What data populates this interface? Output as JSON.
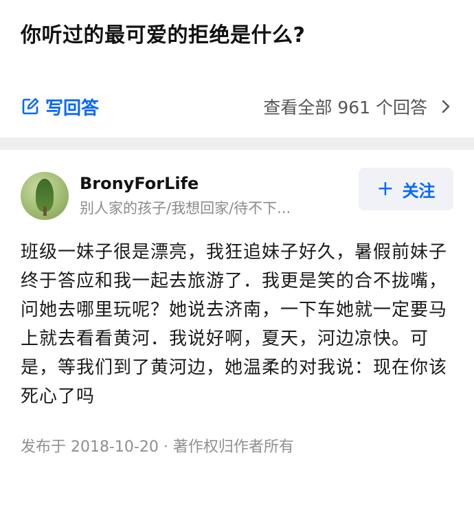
{
  "question": {
    "title": "你听过的最可爱的拒绝是什么?"
  },
  "actions": {
    "write_answer_label": "写回答",
    "view_all_label": "查看全部 961 个回答"
  },
  "answer": {
    "author_name": "BronyForLife",
    "author_bio": "别人家的孩子/我想回家/待不下...",
    "follow_label": "关注",
    "body": "班级一妹子很是漂亮，我狂追妹子好久，暑假前妹子终于答应和我一起去旅游了．我更是笑的合不拢嘴，问她去哪里玩呢？她说去济南，一下车她就一定要马上就去看看黄河．我说好啊，夏天，河边凉快。可是，等我们到了黄河边，她温柔的对我说：现在你该死心了吗",
    "meta": "发布于 2018-10-20 · 著作权归作者所有"
  },
  "colors": {
    "accent": "#0066ff",
    "divider": "#eeeeee",
    "muted": "#8f8f8f",
    "follow_bg": "#f0f2f7"
  },
  "icons": {
    "write": "edit-square-icon",
    "view_all": "chevron-right-icon",
    "follow": "plus-icon"
  }
}
